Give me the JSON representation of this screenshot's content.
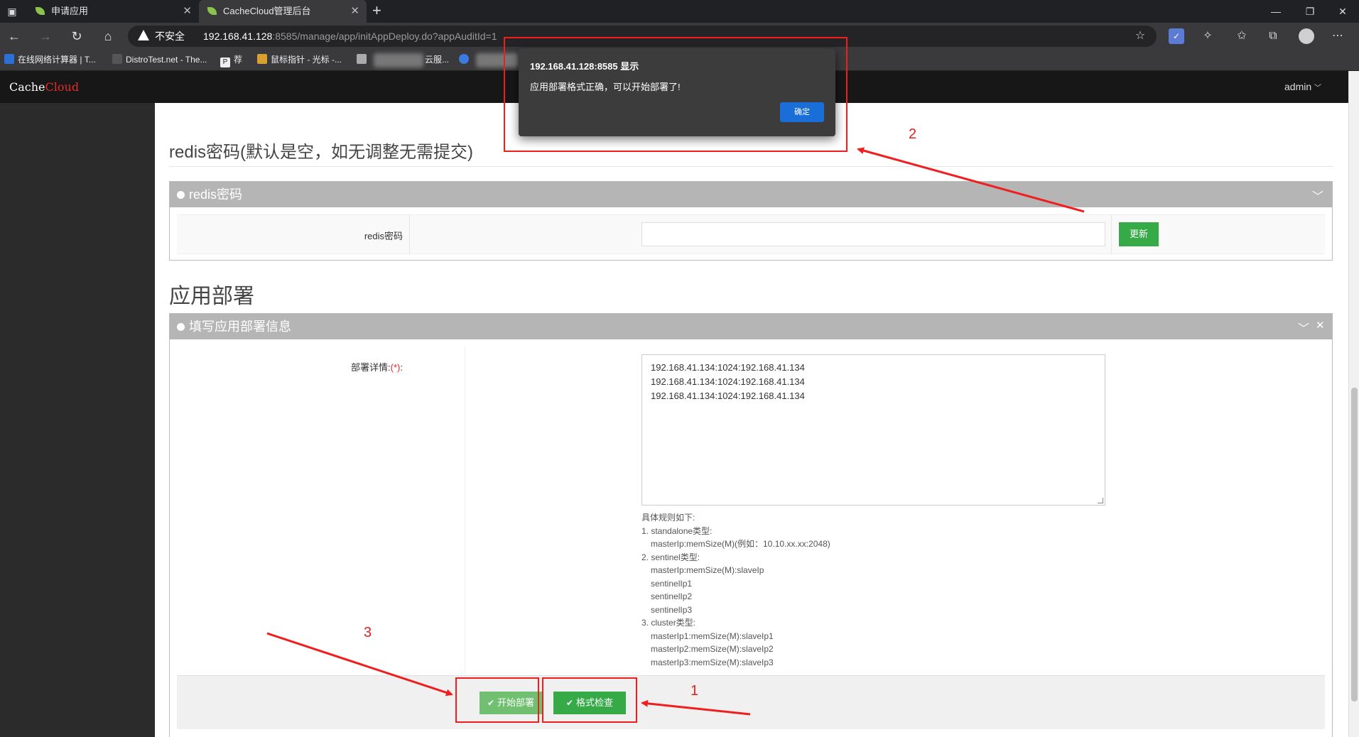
{
  "browser": {
    "tabs": [
      {
        "label": "申请应用"
      },
      {
        "label": "CacheCloud管理后台"
      }
    ],
    "new_tab": "+",
    "security_warning": "不安全",
    "url_host": "192.168.41.128",
    "url_rest": ":8585/manage/app/initAppDeploy.do?appAuditId=1",
    "bookmarks": [
      {
        "label": "在线网络计算器 | T..."
      },
      {
        "label": "DistroTest.net - The..."
      },
      {
        "label": "荐"
      },
      {
        "label": "鼠标指针 - 光标 -..."
      },
      {
        "label": "云服..."
      }
    ]
  },
  "app": {
    "brand_main": "Cache",
    "brand_accent": "Cloud",
    "user": "admin"
  },
  "password_section": {
    "heading": "redis密码(默认是空，如无调整无需提交)",
    "panel_title": "redis密码",
    "field_label": "redis密码",
    "field_value": "",
    "update_button": "更新"
  },
  "deploy_section": {
    "heading": "应用部署",
    "panel_title": "填写应用部署信息",
    "detail_label": "部署详情:",
    "required_mark": "(*)",
    "detail_label_suffix": ":",
    "detail_lines": [
      "192.168.41.134:1024:192.168.41.134",
      "192.168.41.134:1024:192.168.41.134",
      "192.168.41.134:1024:192.168.41.134"
    ],
    "rules": [
      {
        "text": "具体规则如下:",
        "indent": false
      },
      {
        "text": "1. standalone类型:",
        "indent": false
      },
      {
        "text": "masterIp:memSize(M)(例如：10.10.xx.xx:2048)",
        "indent": true
      },
      {
        "text": "2. sentinel类型:",
        "indent": false
      },
      {
        "text": "masterIp:memSize(M):slaveIp",
        "indent": true
      },
      {
        "text": "sentinelIp1",
        "indent": true
      },
      {
        "text": "sentinelIp2",
        "indent": true
      },
      {
        "text": "sentinelIp3",
        "indent": true
      },
      {
        "text": "3. cluster类型:",
        "indent": false
      },
      {
        "text": "masterIp1:memSize(M):slaveIp1",
        "indent": true
      },
      {
        "text": "masterIp2:memSize(M):slaveIp2",
        "indent": true
      },
      {
        "text": "masterIp3:memSize(M):slaveIp3",
        "indent": true
      }
    ],
    "start_button": "开始部署",
    "check_button": "格式检查"
  },
  "dialog": {
    "title": "192.168.41.128:8585 显示",
    "message": "应用部署格式正确，可以开始部署了!",
    "ok": "确定"
  },
  "annotations": {
    "num1": "1",
    "num2": "2",
    "num3": "3",
    "color": "#f01e1e"
  },
  "colors": {
    "green_button": "#35aa47",
    "panel_header": "#b5b5b5",
    "brand_accent": "#e52b2b",
    "dialog_ok": "#1a6ed8"
  }
}
